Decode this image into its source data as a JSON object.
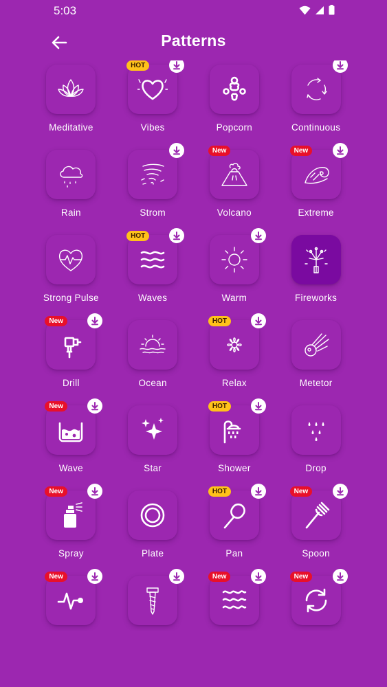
{
  "status": {
    "time": "5:03"
  },
  "appbar": {
    "title": "Patterns"
  },
  "patterns": [
    {
      "label": "Meditative",
      "icon": "lotus-icon",
      "badge": "",
      "download": false
    },
    {
      "label": "Vibes",
      "icon": "heart-icon",
      "badge": "HOT",
      "download": true
    },
    {
      "label": "Popcorn",
      "icon": "popcorn-icon",
      "badge": "",
      "download": false
    },
    {
      "label": "Continuous",
      "icon": "cycle-arrows-icon",
      "badge": "",
      "download": true
    },
    {
      "label": "Rain",
      "icon": "rain-cloud-icon",
      "badge": "",
      "download": false
    },
    {
      "label": "Strom",
      "icon": "tornado-icon",
      "badge": "",
      "download": true
    },
    {
      "label": "Volcano",
      "icon": "volcano-icon",
      "badge": "New",
      "download": false
    },
    {
      "label": "Extreme",
      "icon": "surf-wave-icon",
      "badge": "New",
      "download": true
    },
    {
      "label": "Strong Pulse",
      "icon": "heart-pulse-icon",
      "badge": "",
      "download": false
    },
    {
      "label": "Waves",
      "icon": "waves-icon",
      "badge": "HOT",
      "download": true
    },
    {
      "label": "Warm",
      "icon": "sun-icon",
      "badge": "",
      "download": true
    },
    {
      "label": "Fireworks",
      "icon": "fireworks-icon",
      "badge": "",
      "download": false,
      "selected": true
    },
    {
      "label": "Drill",
      "icon": "drill-icon",
      "badge": "New",
      "download": true
    },
    {
      "label": "Ocean",
      "icon": "sunset-sea-icon",
      "badge": "",
      "download": false
    },
    {
      "label": "Relax",
      "icon": "mandala-flower-icon",
      "badge": "HOT",
      "download": true
    },
    {
      "label": "Metetor",
      "icon": "meteor-icon",
      "badge": "",
      "download": false
    },
    {
      "label": "Wave",
      "icon": "water-container-icon",
      "badge": "New",
      "download": true
    },
    {
      "label": "Star",
      "icon": "sparkle-stars-icon",
      "badge": "",
      "download": false
    },
    {
      "label": "Shower",
      "icon": "shower-icon",
      "badge": "HOT",
      "download": true
    },
    {
      "label": "Drop",
      "icon": "water-drops-icon",
      "badge": "",
      "download": false
    },
    {
      "label": "Spray",
      "icon": "spray-bottle-icon",
      "badge": "New",
      "download": true
    },
    {
      "label": "Plate",
      "icon": "plate-icon",
      "badge": "",
      "download": false
    },
    {
      "label": "Pan",
      "icon": "pan-icon",
      "badge": "HOT",
      "download": true
    },
    {
      "label": "Spoon",
      "icon": "fork-icon",
      "badge": "New",
      "download": true
    },
    {
      "label": "",
      "icon": "pulse-line-icon",
      "badge": "New",
      "download": true
    },
    {
      "label": "",
      "icon": "screw-icon",
      "badge": "",
      "download": true
    },
    {
      "label": "",
      "icon": "wavy-lines-icon",
      "badge": "New",
      "download": true
    },
    {
      "label": "",
      "icon": "refresh-icon",
      "badge": "New",
      "download": true
    }
  ]
}
